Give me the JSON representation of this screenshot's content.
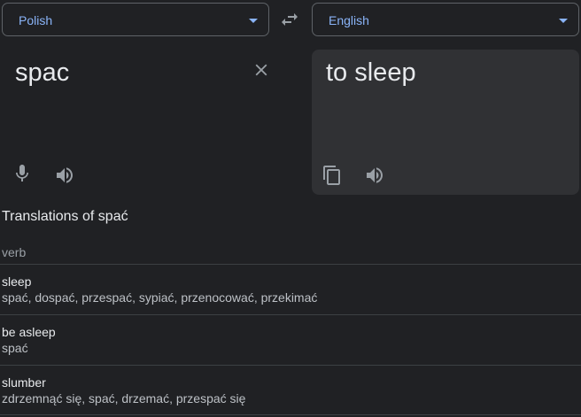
{
  "source_language": "Polish",
  "target_language": "English",
  "source_text": "spac",
  "translated_text": "to sleep",
  "dictionary": {
    "title": "Translations of spać",
    "part_of_speech": "verb",
    "entries": [
      {
        "word": "sleep",
        "back_translations": "spać, dospać, przespać, sypiać, przenocować, przekimać"
      },
      {
        "word": "be asleep",
        "back_translations": "spać"
      },
      {
        "word": "slumber",
        "back_translations": "zdrzemnąć się, spać, drzemać, przespać się"
      }
    ]
  },
  "icons": {
    "swap": "swap-languages-icon",
    "clear": "close-icon",
    "mic": "microphone-icon",
    "speaker": "speaker-icon",
    "copy": "copy-icon",
    "dropdown": "chevron-down-icon"
  },
  "colors": {
    "background": "#202124",
    "panel": "#303134",
    "accent": "#8ab4f8",
    "text": "#e8eaed",
    "muted": "#9aa0a6",
    "divider": "#3c4043"
  }
}
